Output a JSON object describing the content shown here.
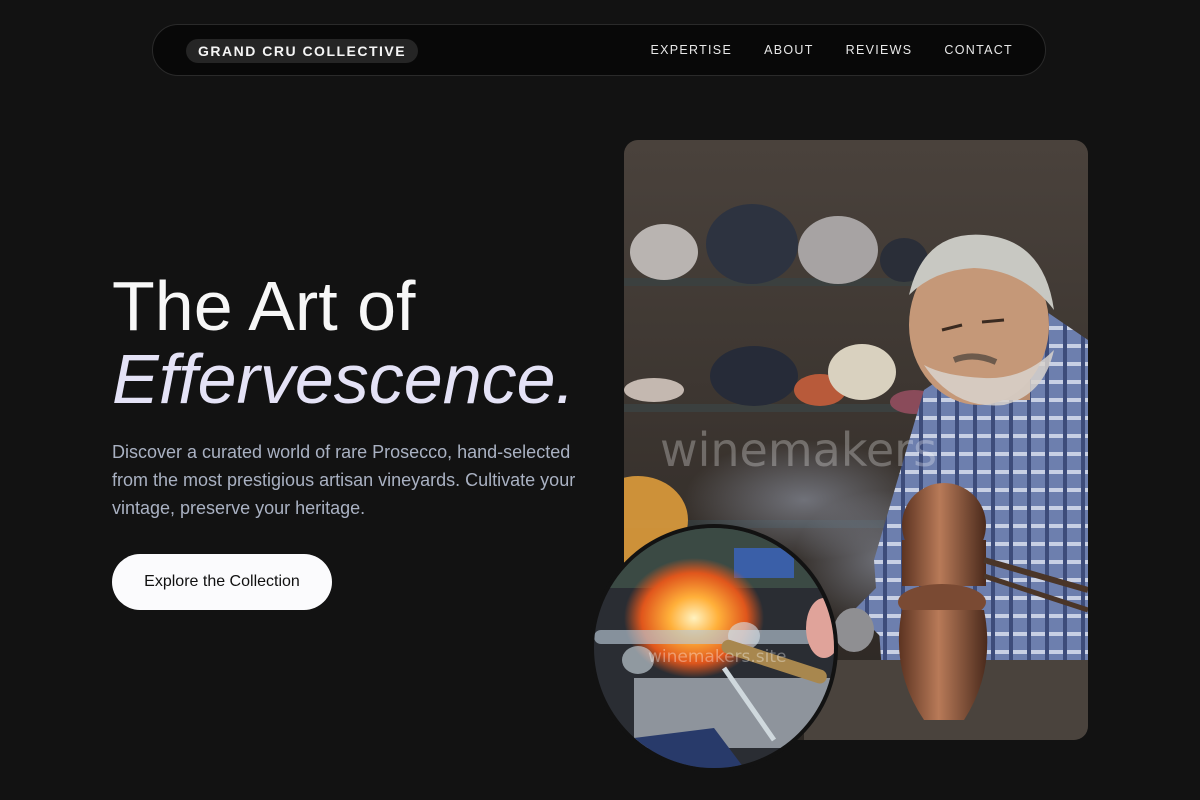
{
  "brand": {
    "name": "GRAND CRU COLLECTIVE"
  },
  "nav": {
    "links": [
      "EXPERTISE",
      "ABOUT",
      "REVIEWS",
      "CONTACT"
    ]
  },
  "hero": {
    "title_line1": "The Art of",
    "title_line2": "Effervescence.",
    "subtitle": "Discover a curated world of rare Prosecco, hand-selected from the most prestigious artisan vineyards. Cultivate your vintage, preserve your heritage.",
    "cta_label": "Explore the Collection"
  },
  "images": {
    "main_watermark": "winemakers",
    "circle_watermark": "winemakers.site"
  },
  "colors": {
    "background": "#121212",
    "accent_italic": "#e4e2f6",
    "subtitle": "#a9b1c2",
    "cta": "#fbfbfd"
  }
}
